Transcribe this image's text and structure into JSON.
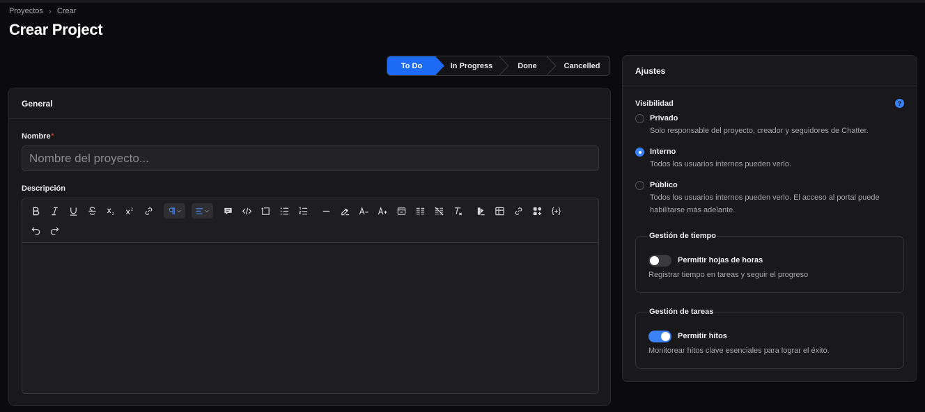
{
  "breadcrumb": {
    "items": [
      "Proyectos",
      "Crear"
    ],
    "separator": "›"
  },
  "page": {
    "title": "Crear Project"
  },
  "status_stepper": {
    "steps": [
      "To Do",
      "In Progress",
      "Done",
      "Cancelled"
    ],
    "active": "To Do",
    "accent_color": "#1d6bf5"
  },
  "general": {
    "title": "General",
    "name_label": "Nombre",
    "name_required_mark": "*",
    "name_placeholder": "Nombre del proyecto...",
    "name_value": "",
    "description_label": "Descripción",
    "description_value": "",
    "toolbar_icons": [
      "bold-icon",
      "italic-icon",
      "underline-icon",
      "strikethrough-icon",
      "subscript-icon",
      "superscript-icon",
      "link-icon",
      "paragraph-icon",
      "align-left-icon",
      "comment-icon",
      "code-icon",
      "text-frame-icon",
      "bullet-list-icon",
      "ordered-list-icon",
      "horizontal-rule-icon",
      "highlight-icon",
      "decrease-font-icon",
      "increase-font-icon",
      "details-icon",
      "columns-icon",
      "clear-columns-icon",
      "clear-format-icon",
      "color-icon",
      "table-icon",
      "attachment-icon",
      "blocks-icon",
      "variable-icon",
      "undo-icon",
      "redo-icon"
    ]
  },
  "settings": {
    "title": "Ajustes",
    "visibility": {
      "label": "Visibilidad",
      "help_glyph": "?",
      "selected": "Interno",
      "options": [
        {
          "title": "Privado",
          "description": "Solo responsable del proyecto, creador y seguidores de Chatter."
        },
        {
          "title": "Interno",
          "description": "Todos los usuarios internos pueden verlo."
        },
        {
          "title": "Público",
          "description": "Todos los usuarios internos pueden verlo. El acceso al portal puede habilitarse más adelante."
        }
      ]
    },
    "time_management": {
      "legend": "Gestión de tiempo",
      "toggle_label": "Permitir hojas de horas",
      "toggle_on": false,
      "description": "Registrar tiempo en tareas y seguir el progreso"
    },
    "task_management": {
      "legend": "Gestión de tareas",
      "toggle_label": "Permitir hitos",
      "toggle_on": true,
      "description": "Monitorear hitos clave esenciales para lograr el éxito."
    }
  },
  "colors": {
    "background": "#0b0b0d",
    "card": "#19191b",
    "accent": "#3b82f6",
    "required": "#ef4444"
  }
}
